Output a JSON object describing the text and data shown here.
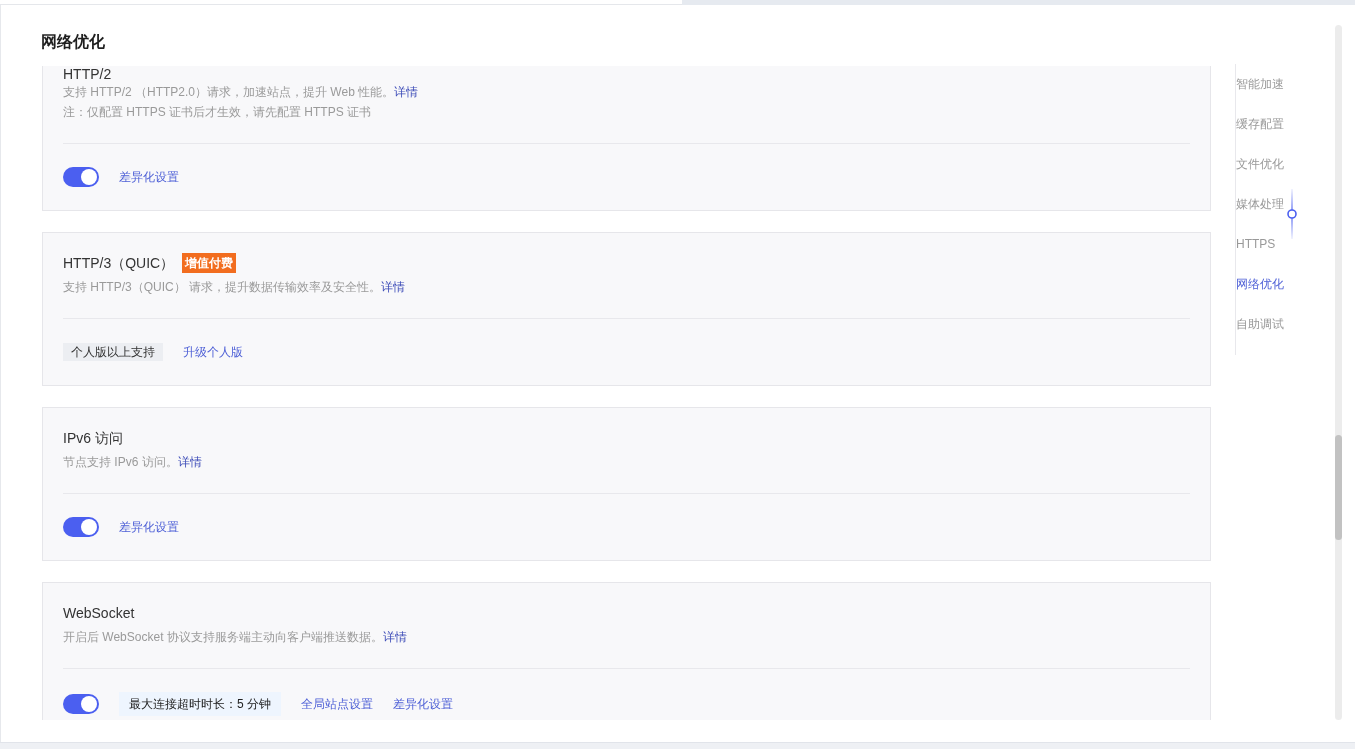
{
  "title": "网络优化",
  "sections": [
    {
      "title": "HTTP/2",
      "description": [
        {
          "text": "支持 HTTP/2 （HTTP2.0）请求，加速站点，提升 Web 性能。",
          "link": "详情"
        },
        {
          "text": "注：仅配置 HTTPS 证书后才生效，请先配置 HTTPS 证书"
        }
      ],
      "controls": [
        {
          "kind": "toggle",
          "on": true
        },
        {
          "kind": "link",
          "label": "差异化设置"
        }
      ]
    },
    {
      "title": "HTTP/3（QUIC）",
      "badge": "增值付费",
      "description": [
        {
          "text": "支持 HTTP/3（QUIC） 请求，提升数据传输效率及安全性。",
          "link": "详情"
        }
      ],
      "controls": [
        {
          "kind": "tag",
          "label": "个人版以上支持"
        },
        {
          "kind": "link",
          "label": "升级个人版"
        }
      ]
    },
    {
      "title": "IPv6 访问",
      "description": [
        {
          "text": "节点支持 IPv6 访问。",
          "link": "详情"
        }
      ],
      "controls": [
        {
          "kind": "toggle",
          "on": true
        },
        {
          "kind": "link",
          "label": "差异化设置"
        }
      ]
    },
    {
      "title": "WebSocket",
      "description": [
        {
          "text": "开启后 WebSocket 协议支持服务端主动向客户端推送数据。",
          "link": "详情"
        }
      ],
      "controls": [
        {
          "kind": "toggle",
          "on": true
        },
        {
          "kind": "info",
          "label": "最大连接超时时长：5 分钟"
        },
        {
          "kind": "link",
          "label": "全局站点设置"
        },
        {
          "kind": "link",
          "label": "差异化设置"
        }
      ]
    }
  ],
  "anchor_nav": {
    "items": [
      {
        "label": "智能加速",
        "selected": false
      },
      {
        "label": "缓存配置",
        "selected": false
      },
      {
        "label": "文件优化",
        "selected": false
      },
      {
        "label": "媒体处理",
        "selected": false
      },
      {
        "label": "HTTPS",
        "selected": false
      },
      {
        "label": "网络优化",
        "selected": true
      },
      {
        "label": "自助调试",
        "selected": false
      }
    ]
  }
}
